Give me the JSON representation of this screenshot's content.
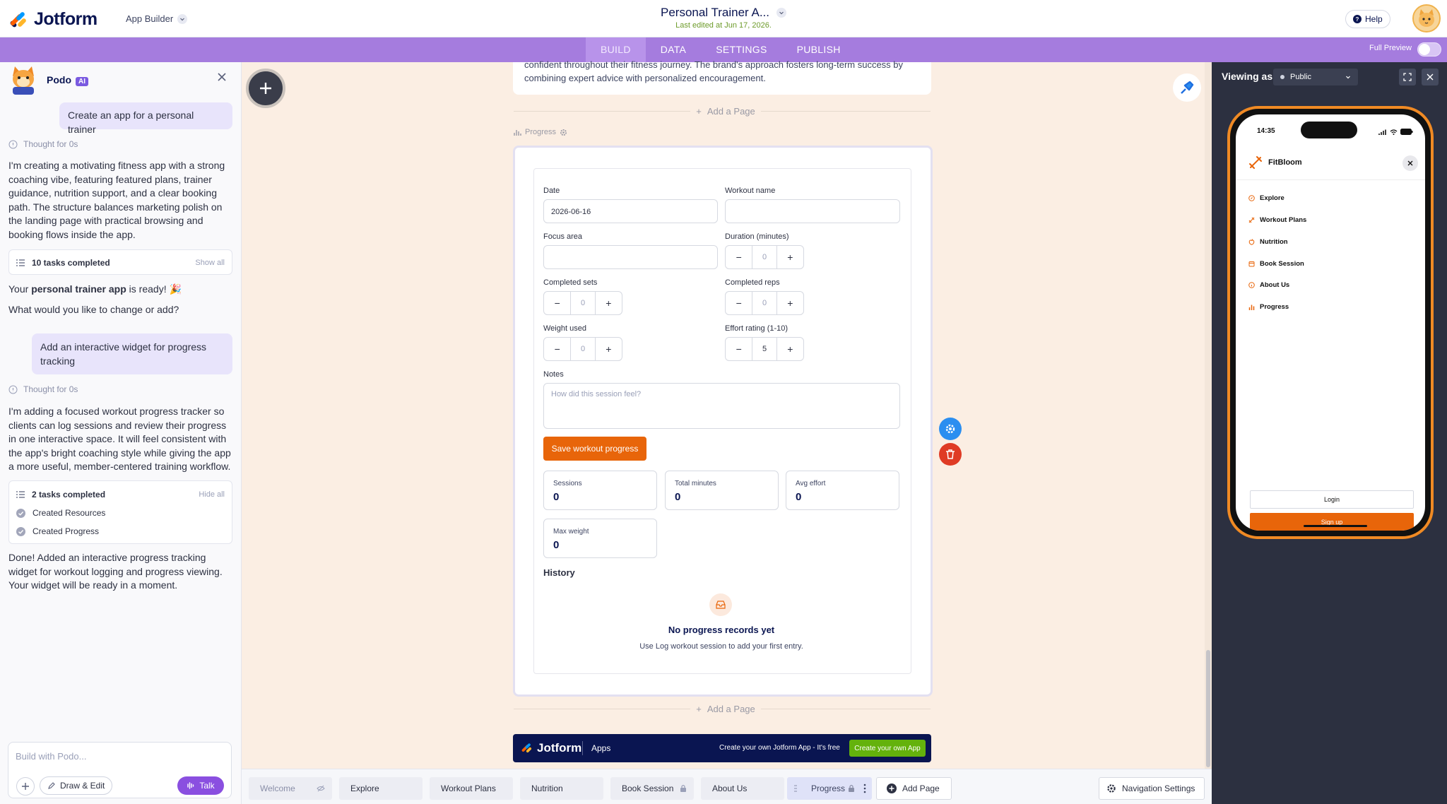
{
  "header": {
    "brand": "Jotform",
    "app_builder_label": "App Builder",
    "app_title": "Personal Trainer A...",
    "last_edited": "Last edited at Jun 17, 2026.",
    "help_label": "Help"
  },
  "nav": {
    "tabs": [
      {
        "label": "BUILD",
        "active": true
      },
      {
        "label": "DATA",
        "active": false
      },
      {
        "label": "SETTINGS",
        "active": false
      },
      {
        "label": "PUBLISH",
        "active": false
      }
    ],
    "full_preview_label": "Full Preview",
    "full_preview_on": false
  },
  "chat": {
    "assistant_name": "Podo",
    "assistant_badge": "AI",
    "messages": {
      "user1": "Create an app for a personal trainer",
      "thought1": "Thought for 0s",
      "reply1": "I'm creating a motivating fitness app with a strong coaching vibe, featuring featured plans, trainer guidance, nutrition support, and a clear booking path. The structure balances marketing polish on the landing page with practical browsing and booking flows inside the app.",
      "tasks1": "10 tasks completed",
      "tasks1_link": "Show all",
      "ready_prefix": "Your ",
      "ready_bold": "personal trainer app",
      "ready_suffix": " is ready! 🎉",
      "ask": "What would you like to change or add?",
      "user2": "Add an interactive widget for progress tracking",
      "thought2": "Thought for 0s",
      "reply2": "I'm adding a focused workout progress tracker so clients can log sessions and review their progress in one interactive space. It will feel consistent with the app's bright coaching style while giving the app a more useful, member-centered training workflow.",
      "tasks2": "2 tasks completed",
      "tasks2_link": "Hide all",
      "task_items": [
        "Created Resources",
        "Created Progress"
      ],
      "done": "Done! Added an interactive progress tracking widget for workout logging and progress viewing. Your widget will be ready in a moment."
    },
    "input_placeholder": "Build with Podo...",
    "draw_edit_label": "Draw & Edit",
    "talk_label": "Talk"
  },
  "canvas": {
    "prev_text": "confident throughout their fitness journey. The brand's approach fosters long-term success by combining expert advice with personalized encouragement.",
    "add_page_label": "Add a Page",
    "page_label": "Progress",
    "form": {
      "date_label": "Date",
      "date_value": "2026-06-16",
      "workout_name_label": "Workout name",
      "workout_name_value": "",
      "focus_area_label": "Focus area",
      "focus_area_value": "",
      "duration_label": "Duration (minutes)",
      "duration_value": "0",
      "sets_label": "Completed sets",
      "sets_value": "0",
      "reps_label": "Completed reps",
      "reps_value": "0",
      "weight_label": "Weight used",
      "weight_value": "0",
      "effort_label": "Effort rating (1-10)",
      "effort_value": "5",
      "notes_label": "Notes",
      "notes_placeholder": "How did this session feel?",
      "save_label": "Save workout progress",
      "stats": [
        {
          "label": "Sessions",
          "value": "0"
        },
        {
          "label": "Total minutes",
          "value": "0"
        },
        {
          "label": "Avg effort",
          "value": "0"
        },
        {
          "label": "Max weight",
          "value": "0"
        }
      ],
      "history_label": "History",
      "empty_title": "No progress records yet",
      "empty_sub": "Use Log workout session to add your first entry."
    },
    "banner": {
      "brand": "Jotform",
      "apps": "Apps",
      "text": "Create your own Jotform App - It's free",
      "cta": "Create your own App"
    }
  },
  "page_tabs": [
    {
      "label": "Welcome",
      "active": false
    },
    {
      "label": "Explore",
      "active": false
    },
    {
      "label": "Workout Plans",
      "active": false
    },
    {
      "label": "Nutrition",
      "active": false
    },
    {
      "label": "Book Session",
      "active": false
    },
    {
      "label": "About Us",
      "active": false
    },
    {
      "label": "Progress",
      "active": true
    }
  ],
  "add_page_tab": "Add Page",
  "nav_settings": "Navigation Settings",
  "preview": {
    "viewing_as": "Viewing as",
    "audience": "Public",
    "phone_time": "14:35",
    "app_name": "FitBloom",
    "menu": [
      "Explore",
      "Workout Plans",
      "Nutrition",
      "Book Session",
      "About Us",
      "Progress"
    ],
    "login": "Login",
    "signup": "Sign up"
  },
  "colors": {
    "accent_purple": "#a57cde",
    "primary_orange": "#e8650a",
    "brand_navy": "#0a1551",
    "canvas_bg": "#fbeee3",
    "cta_green": "#64b20c"
  }
}
